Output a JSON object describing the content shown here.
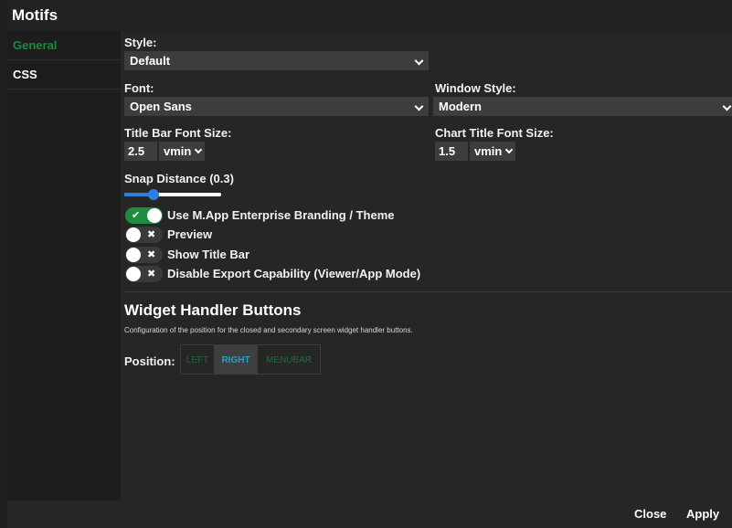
{
  "window": {
    "title": "Motifs"
  },
  "sidebar": {
    "items": [
      {
        "label": "General",
        "active": true
      },
      {
        "label": "CSS",
        "active": false
      }
    ]
  },
  "general": {
    "style": {
      "label": "Style:",
      "value": "Default"
    },
    "font": {
      "label": "Font:",
      "value": "Open Sans"
    },
    "window_style": {
      "label": "Window Style:",
      "value": "Modern"
    },
    "title_bar_font_size": {
      "label": "Title Bar Font Size:",
      "value": "2.5",
      "unit": "vmin"
    },
    "chart_title_font_size": {
      "label": "Chart Title Font Size:",
      "value": "1.5",
      "unit": "vmin"
    },
    "snap_distance": {
      "label": "Snap Distance (0.3)",
      "value": 0.3
    },
    "toggles": [
      {
        "label": "Use M.App Enterprise Branding / Theme",
        "on": true,
        "icon": "check-icon",
        "mark": "✔"
      },
      {
        "label": "Preview",
        "on": false,
        "icon": "x-icon",
        "mark": "✖"
      },
      {
        "label": "Show Title Bar",
        "on": false,
        "icon": "x-icon",
        "mark": "✖"
      },
      {
        "label": "Disable Export Capability (Viewer/App Mode)",
        "on": false,
        "icon": "x-icon",
        "mark": "✖"
      }
    ]
  },
  "widget_handler": {
    "title": "Widget Handler Buttons",
    "description": "Configuration of the position for the closed and secondary screen widget handler buttons.",
    "position_label": "Position:",
    "options": [
      "LEFT",
      "RIGHT",
      "MENUBAR"
    ],
    "selected": "RIGHT"
  },
  "footer": {
    "close_label": "Close",
    "apply_label": "Apply"
  },
  "colors": {
    "background": "#262626",
    "sidebar": "#1d1d1d",
    "accent_green": "#1e8e3e",
    "slider_blue": "#2a80e0",
    "selected_option_text": "#23a2cc",
    "field_background": "#3d3d3d"
  }
}
